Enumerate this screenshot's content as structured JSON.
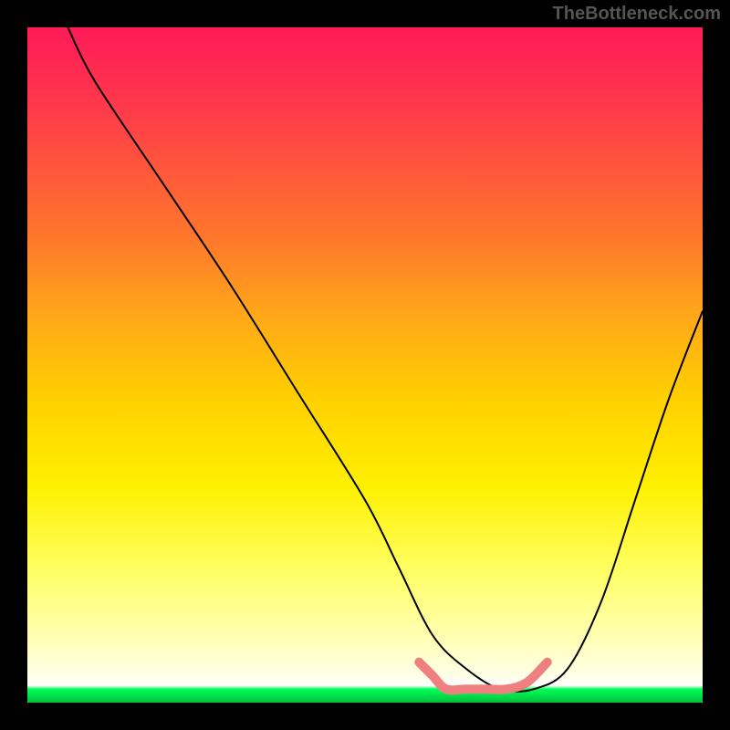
{
  "watermark": "TheBottleneck.com",
  "chart_data": {
    "type": "line",
    "title": "",
    "xlabel": "",
    "ylabel": "",
    "xlim": [
      0,
      100
    ],
    "ylim": [
      0,
      100
    ],
    "grid": false,
    "series": [
      {
        "name": "black-curve",
        "color": "#000000",
        "x": [
          6,
          10,
          20,
          30,
          40,
          50,
          55,
          60,
          65,
          70,
          75,
          80,
          85,
          90,
          95,
          100
        ],
        "y": [
          100,
          92,
          77,
          62,
          46,
          30,
          20,
          10,
          5,
          2,
          2,
          5,
          15,
          30,
          45,
          58
        ]
      },
      {
        "name": "salmon-highlight",
        "color": "#f08080",
        "x": [
          58,
          60,
          62,
          65,
          68,
          71,
          74,
          77
        ],
        "y": [
          6,
          4,
          2,
          2,
          2,
          2,
          3,
          6
        ]
      }
    ],
    "background_gradient": {
      "direction": "top-to-bottom",
      "stops": [
        {
          "pct": 0,
          "color": "#ff1a58"
        },
        {
          "pct": 22,
          "color": "#ff5a3a"
        },
        {
          "pct": 42,
          "color": "#ffa51a"
        },
        {
          "pct": 68,
          "color": "#fff000"
        },
        {
          "pct": 90,
          "color": "#ffffb0"
        },
        {
          "pct": 97.5,
          "color": "#ffffff"
        },
        {
          "pct": 100,
          "color": "#00c040"
        }
      ]
    }
  }
}
